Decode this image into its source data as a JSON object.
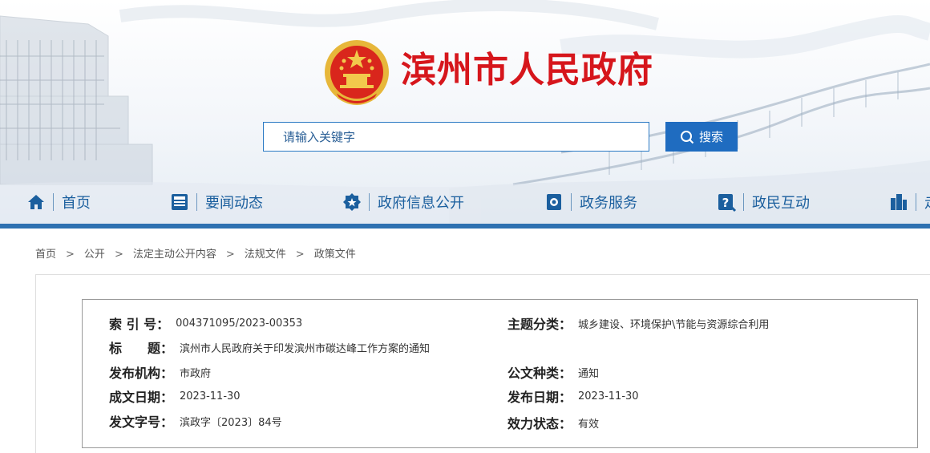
{
  "site": {
    "title": "滨州市人民政府"
  },
  "search": {
    "placeholder": "请输入关键字",
    "button_label": "搜索"
  },
  "nav": {
    "items": [
      {
        "label": "首页",
        "icon": "home-icon"
      },
      {
        "label": "要闻动态",
        "icon": "news-icon"
      },
      {
        "label": "政府信息公开",
        "icon": "badge-icon"
      },
      {
        "label": "政务服务",
        "icon": "service-icon"
      },
      {
        "label": "政民互动",
        "icon": "question-icon"
      },
      {
        "label": "走",
        "icon": "building-icon"
      }
    ]
  },
  "breadcrumb": [
    "首页",
    "公开",
    "法定主动公开内容",
    "法规文件",
    "政策文件"
  ],
  "breadcrumb_separator": ">",
  "document_info": {
    "index_no": {
      "label": "索 引 号：",
      "value": "004371095/2023-00353"
    },
    "topic": {
      "label": "主题分类：",
      "value": "城乡建设、环境保护\\节能与资源综合利用"
    },
    "title": {
      "label": "标　　题：",
      "value": "滨州市人民政府关于印发滨州市碳达峰工作方案的通知"
    },
    "publisher": {
      "label": "发布机构：",
      "value": "市政府"
    },
    "doc_type": {
      "label": "公文种类：",
      "value": "通知"
    },
    "written_date": {
      "label": "成文日期：",
      "value": "2023-11-30"
    },
    "publish_date": {
      "label": "发布日期：",
      "value": "2023-11-30"
    },
    "doc_number": {
      "label": "发文字号：",
      "value": "滨政字〔2023〕84号"
    },
    "validity": {
      "label": "效力状态：",
      "value": "有效"
    }
  },
  "colors": {
    "title_red": "#d6161c",
    "nav_blue": "#1b5f9e",
    "search_blue": "#1f6cc0",
    "bar_blue": "#2e71b1"
  }
}
